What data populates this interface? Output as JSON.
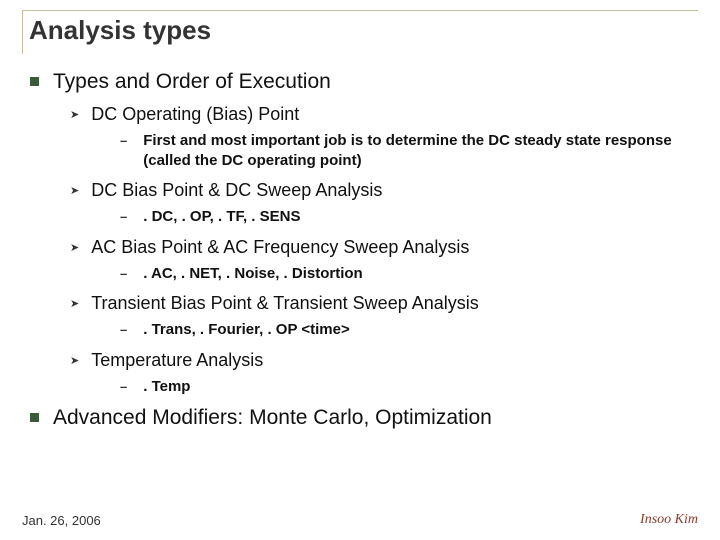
{
  "title": "Analysis types",
  "l1a": "Types and Order of Execution",
  "l2a": "DC Operating (Bias) Point",
  "l3a": "First and most important job is to determine the DC steady state response (called the DC operating point)",
  "l2b": "DC Bias Point & DC Sweep Analysis",
  "l3b": ". DC, . OP, . TF, . SENS",
  "l2c": "AC Bias Point & AC Frequency Sweep Analysis",
  "l3c": ". AC, . NET, . Noise, . Distortion",
  "l2d": "Transient Bias Point & Transient Sweep Analysis",
  "l3d": ". Trans, . Fourier, . OP <time>",
  "l2e": "Temperature Analysis",
  "l3e": ". Temp",
  "l1b": "Advanced Modifiers:  Monte Carlo, Optimization",
  "date": "Jan. 26, 2006",
  "author": "Insoo Kim"
}
